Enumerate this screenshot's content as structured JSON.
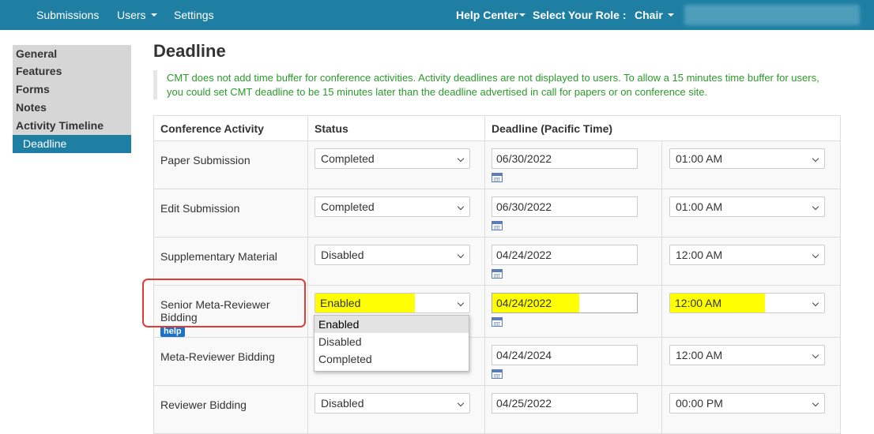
{
  "topnav": {
    "items": [
      "Submissions",
      "Users",
      "Settings"
    ],
    "help_center": "Help Center",
    "role_label": "Select Your Role :",
    "role_value": "Chair"
  },
  "sidebar": {
    "items": [
      "General",
      "Features",
      "Forms",
      "Notes",
      "Activity Timeline"
    ],
    "active_sub": "Deadline"
  },
  "page": {
    "title": "Deadline",
    "notice_line1": "CMT does not add time buffer for conference activities. Activity deadlines are not displayed to users. To allow a 15 minutes time buffer for users,",
    "notice_line2": "you could set CMT deadline to be 15 minutes later than the deadline advertised in call for papers or on conference site."
  },
  "table": {
    "headers": [
      "Conference Activity",
      "Status",
      "Deadline (Pacific Time)"
    ],
    "rows": [
      {
        "activity": "Paper Submission",
        "status": "Completed",
        "date": "06/30/2022",
        "time": "01:00 AM"
      },
      {
        "activity": "Edit Submission",
        "status": "Completed",
        "date": "06/30/2022",
        "time": "01:00 AM"
      },
      {
        "activity": "Supplementary Material",
        "status": "Disabled",
        "date": "04/24/2022",
        "time": "12:00 AM"
      },
      {
        "activity": "Senior Meta-Reviewer Bidding",
        "help": "help",
        "status": "Enabled",
        "date": "04/24/2022",
        "time": "12:00 AM"
      },
      {
        "activity": "Meta-Reviewer Bidding",
        "status": "",
        "date": "04/24/2024",
        "time": "12:00 AM"
      },
      {
        "activity": "Reviewer Bidding",
        "status": "Disabled",
        "date": "04/25/2022",
        "time": "00:00 PM"
      }
    ]
  },
  "status_dropdown": {
    "options": [
      "Enabled",
      "Disabled",
      "Completed"
    ],
    "selected": "Enabled"
  },
  "colors": {
    "nav_bg": "#1f7fa3",
    "notice_text": "#2b9a2b",
    "highlight": "#ffff00",
    "annotation_box": "#e53935"
  }
}
